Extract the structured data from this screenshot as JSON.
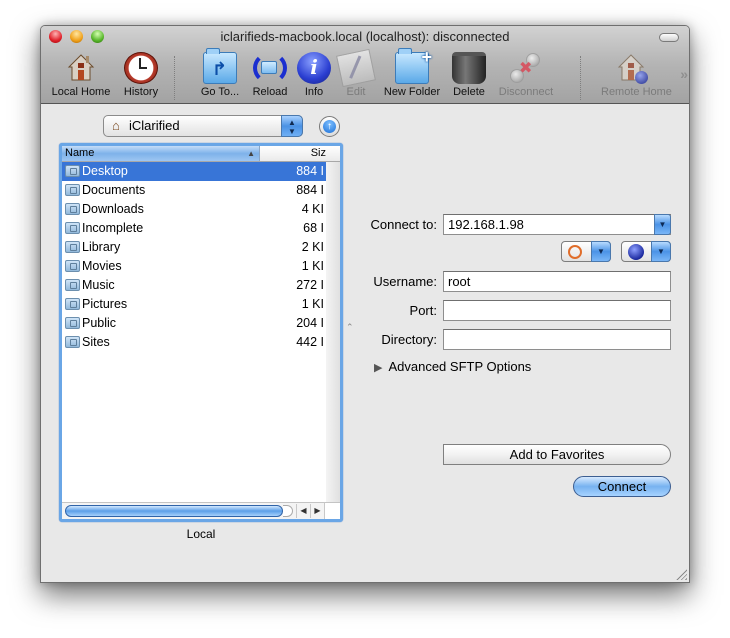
{
  "window": {
    "title": "iclarifieds-macbook.local (localhost): disconnected"
  },
  "toolbar": {
    "items": [
      {
        "label": "Local Home",
        "icon": "local-home-icon",
        "enabled": true
      },
      {
        "label": "History",
        "icon": "history-clock-icon",
        "enabled": true
      },
      {
        "label": "Go To...",
        "icon": "goto-folder-icon",
        "enabled": true
      },
      {
        "label": "Reload",
        "icon": "reload-icon",
        "enabled": true
      },
      {
        "label": "Info",
        "icon": "info-icon",
        "enabled": true
      },
      {
        "label": "Edit",
        "icon": "edit-icon",
        "enabled": false
      },
      {
        "label": "New Folder",
        "icon": "new-folder-icon",
        "enabled": true
      },
      {
        "label": "Delete",
        "icon": "trash-icon",
        "enabled": true
      },
      {
        "label": "Disconnect",
        "icon": "disconnect-icon",
        "enabled": false
      },
      {
        "label": "Remote Home",
        "icon": "remote-home-icon",
        "enabled": false
      }
    ],
    "overflow": "»"
  },
  "local_panel": {
    "path": "iClarified",
    "columns": {
      "name": "Name",
      "size": "Siz"
    },
    "files": [
      {
        "name": "Desktop",
        "size": "884 I",
        "selected": true
      },
      {
        "name": "Documents",
        "size": "884 I",
        "selected": false
      },
      {
        "name": "Downloads",
        "size": "4 KI",
        "selected": false
      },
      {
        "name": "Incomplete",
        "size": "68 I",
        "selected": false
      },
      {
        "name": "Library",
        "size": "2 KI",
        "selected": false
      },
      {
        "name": "Movies",
        "size": "1 KI",
        "selected": false
      },
      {
        "name": "Music",
        "size": "272 I",
        "selected": false
      },
      {
        "name": "Pictures",
        "size": "1 KI",
        "selected": false
      },
      {
        "name": "Public",
        "size": "204 I",
        "selected": false
      },
      {
        "name": "Sites",
        "size": "442 I",
        "selected": false
      }
    ],
    "label": "Local"
  },
  "connect_form": {
    "connect_to_label": "Connect to:",
    "connect_to_value": "192.168.1.98",
    "username_label": "Username:",
    "username_value": "root",
    "port_label": "Port:",
    "port_value": "",
    "directory_label": "Directory:",
    "directory_value": "",
    "advanced_label": "Advanced SFTP Options",
    "add_favorites_label": "Add to Favorites",
    "connect_label": "Connect"
  },
  "colors": {
    "selection": "#3875d7",
    "focus_ring": "#6aa6e6",
    "window_bg": "#e8e8e8"
  }
}
